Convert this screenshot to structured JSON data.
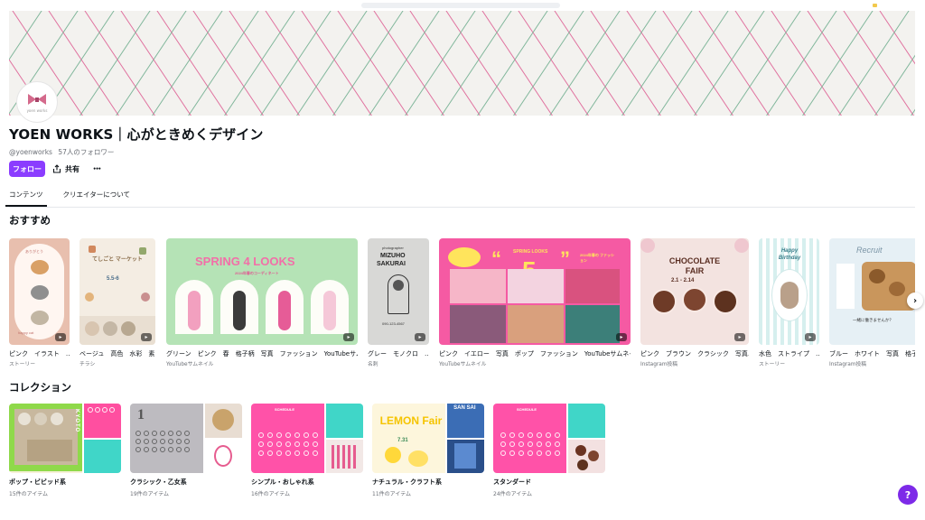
{
  "profile": {
    "name": "YOEN WORKS｜心がときめくデザイン",
    "handle": "@yoenworks",
    "followers": "57人のフォロワー",
    "avatar_text": "yoen works"
  },
  "actions": {
    "follow_label": "フォロー",
    "share_label": "共有",
    "more_label": "•••"
  },
  "tabs": [
    {
      "label": "コンテンツ",
      "active": true
    },
    {
      "label": "クリエイターについて",
      "active": false
    }
  ],
  "sections": {
    "recommended_title": "おすすめ",
    "collections_title": "コレクション"
  },
  "recommended": [
    {
      "label": "ピンク　イラスト　…",
      "sub": "ストーリー",
      "art": {
        "top": "ありがとう",
        "bottom": "happy cat"
      }
    },
    {
      "label": "ベージュ　高色　水彩　素…",
      "sub": "チラシ",
      "art": {
        "top": "てしごと マーケット",
        "date": "5.5-6"
      }
    },
    {
      "label": "グリーン　ピンク　春　格子柄　写真　ファッション　YouTubeサム…",
      "sub": "YouTubeサムネイル",
      "art": {
        "title": "SPRING 4 LOOKS",
        "sub": "2024年春のコーディネート"
      }
    },
    {
      "label": "グレー　モノクロ　…",
      "sub": "名刺",
      "art": {
        "top": "photographer",
        "name1": "MIZUHO",
        "name2": "SAKURAI",
        "tel": "090-123-4567"
      }
    },
    {
      "label": "ピンク　イエロー　写真　ポップ　ファッション　YouTubeサムネイル",
      "sub": "YouTubeサムネイル",
      "art": {
        "title": "SPRING LOOKS",
        "num": "5",
        "right": "2024年春の ファッション"
      }
    },
    {
      "label": "ピンク　ブラウン　クラシック　写真…",
      "sub": "Instagram投稿",
      "art": {
        "title": "CHOCOLATE FAIR",
        "date": "2.1 - 2.14"
      }
    },
    {
      "label": "水色　ストライプ　…",
      "sub": "ストーリー",
      "art": {
        "title": "Happy Birthday"
      }
    },
    {
      "label": "ブルー　ホワイト　写真　格子柄",
      "sub": "Instagram投稿",
      "art": {
        "title": "Recruit",
        "sub": "一緒に働きませんか？"
      }
    }
  ],
  "collections": [
    {
      "label": "ポップ・ビビッド系",
      "count": "15件のアイテム",
      "art": "KYOTO"
    },
    {
      "label": "クラシック・乙女系",
      "count": "19件のアイテム",
      "art": "1"
    },
    {
      "label": "シンプル・おしゃれ系",
      "count": "16件のアイテム",
      "art": "SCHEDULE"
    },
    {
      "label": "ナチュラル・クラフト系",
      "count": "11件のアイテム",
      "art": "LEMON Fair",
      "date": "7.31",
      "side": "SAN SAI"
    },
    {
      "label": "スタンダード",
      "count": "24件のアイテム",
      "art": "SCHEDULE"
    }
  ],
  "colors": {
    "accent": "#8b3dff",
    "help": "#7d2ae8",
    "banner_pink": "#e0709e",
    "banner_green": "#7fb59a"
  },
  "icons": {
    "share": "share-icon",
    "more": "more-icon",
    "next": "chevron-right-icon",
    "help": "help-icon",
    "badge": "video-badge-icon"
  },
  "help_label": "?"
}
